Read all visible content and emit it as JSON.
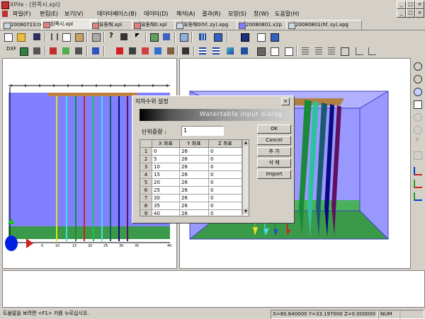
{
  "window": {
    "title": "XPile - [왼쪽시.xpl]",
    "minimize": "_",
    "maximize": "□",
    "close": "×"
  },
  "menu": [
    "파일(F)",
    "편집(E)",
    "보기(V)",
    "데이터베이스(B)",
    "데이터(D)",
    "해석(A)",
    "결과(R)",
    "모양(S)",
    "창(W)",
    "도움말(H)"
  ],
  "tabs": [
    "20080723.txt",
    "왼쪽시.xpl",
    "유동해.xpl",
    "유동해0.xpl",
    "유동해0(hf..zy).xpg",
    "20080801.x2p",
    "20080801(hf..sy).xpg"
  ],
  "active_tab": 1,
  "statusbar": {
    "help": "도움말을 보려면 <F1> 키를 누르십시오.",
    "coords": "X=80.640000 Y=33.197000 Z=0.000000",
    "num": "NUM"
  },
  "dialog": {
    "title": "지하수위 설정",
    "banner": "Watertable input dialog",
    "unit_label": "단위중량 :",
    "unit_value": "1",
    "buttons": [
      "OK",
      "Cancel",
      "추  가",
      "삭  제",
      "Import"
    ],
    "columns": [
      "X 좌표",
      "Y 좌표",
      "Z 좌표"
    ],
    "rows": [
      [
        "1",
        "0",
        "26",
        "0"
      ],
      [
        "2",
        "5",
        "26",
        "0"
      ],
      [
        "3",
        "10",
        "26",
        "0"
      ],
      [
        "4",
        "15",
        "26",
        "0"
      ],
      [
        "5",
        "20",
        "26",
        "0"
      ],
      [
        "6",
        "25",
        "26",
        "0"
      ],
      [
        "7",
        "30",
        "26",
        "0"
      ],
      [
        "8",
        "35",
        "26",
        "0"
      ],
      [
        "9",
        "40",
        "26",
        "0"
      ]
    ]
  },
  "left_view": {
    "axis_ticks": [
      "0",
      "10",
      "15",
      "20",
      "25",
      "30",
      "35",
      "40"
    ]
  },
  "colors": {
    "blue_region": "#8080ff",
    "green_ground": "#3a9a4a",
    "title_bg": "#d4d0c8"
  }
}
